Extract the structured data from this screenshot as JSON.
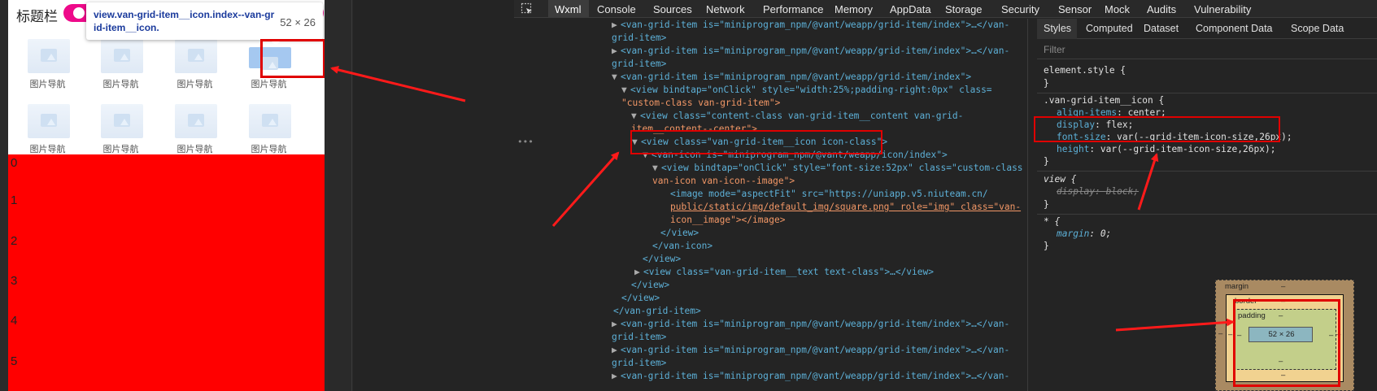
{
  "simulator": {
    "nav_title": "标题栏",
    "grid_items": [
      {
        "label": "图片导航"
      },
      {
        "label": "图片导航"
      },
      {
        "label": "图片导航"
      },
      {
        "label": "图片导航"
      },
      {
        "label": "图片导航"
      },
      {
        "label": "图片导航"
      },
      {
        "label": "图片导航"
      },
      {
        "label": "图片导航"
      }
    ],
    "red_area_numbers": [
      "0",
      "1",
      "2",
      "3",
      "4",
      "5"
    ],
    "tooltip": {
      "selector": "view.van-grid-item__icon.index--van-grid-item__icon.",
      "dimensions": "52 × 26"
    }
  },
  "devtools": {
    "tabs": [
      "Wxml",
      "Console",
      "Sources",
      "Network",
      "Performance",
      "Memory",
      "AppData",
      "Storage",
      "Security",
      "Sensor",
      "Mock",
      "Audits",
      "Vulnerability"
    ],
    "active_tab": "Wxml",
    "dom_lines": {
      "l1a": "<van-grid-item is=\"miniprogram_npm/@vant/weapp/grid-item/index\">…</van-",
      "l1b": "grid-item>",
      "l2a": "<van-grid-item is=\"miniprogram_npm/@vant/weapp/grid-item/index\">…</van-",
      "l2b": "grid-item>",
      "l3": "<van-grid-item is=\"miniprogram_npm/@vant/weapp/grid-item/index\">",
      "l4a": "<view bindtap=\"onClick\" style=\"width:25%;padding-right:0px\" class=",
      "l4b": "\"custom-class van-grid-item\">",
      "l5a": "<view class=\"content-class van-grid-item__content van-grid-",
      "l5b": "item__content--center\">",
      "l6": "<view class=\"van-grid-item__icon icon-class\">",
      "l7": "<van-icon is=\"miniprogram_npm/@vant/weapp/icon/index\">",
      "l8a": "<view bindtap=\"onClick\" style=\"font-size:52px\" class=\"custom-class",
      "l8b": "van-icon van-icon--image\">",
      "l9a": "<image mode=\"aspectFit\" src=\"https://uniapp.v5.niuteam.cn/",
      "l9b": "public/static/img/default_img/square.png\" role=\"img\" class=\"van-",
      "l9c": "icon__image\"></image>",
      "l10": "</view>",
      "l11": "</van-icon>",
      "l12": "</view>",
      "l13": "<view class=\"van-grid-item__text text-class\">…</view>",
      "l14": "</view>",
      "l15": "</view>",
      "l16": "</van-grid-item>",
      "l17a": "<van-grid-item is=\"miniprogram_npm/@vant/weapp/grid-item/index\">…</van-",
      "l17b": "grid-item>",
      "l18a": "<van-grid-item is=\"miniprogram_npm/@vant/weapp/grid-item/index\">…</van-",
      "l18b": "grid-item>",
      "l19": "<van-grid-item is=\"miniprogram_npm/@vant/weapp/grid-item/index\">…</van-"
    },
    "side_tabs": [
      "Styles",
      "Computed",
      "Dataset",
      "Component Data",
      "Scope Data"
    ],
    "active_side_tab": "Styles",
    "filter_placeholder": "Filter",
    "styles": {
      "element_style": "element.style {",
      "close": "}",
      "rule1_selector": ".van-grid-item__icon {",
      "rule1_props": [
        {
          "name": "align-items",
          "value": "center;"
        },
        {
          "name": "display",
          "value": "flex;"
        },
        {
          "name": "font-size",
          "value": "var(--grid-item-icon-size,26px);"
        },
        {
          "name": "height",
          "value": "var(--grid-item-icon-size,26px);"
        }
      ],
      "rule2_selector": "view {",
      "rule2_prop": {
        "name": "display",
        "value": "block;"
      },
      "rule3_selector": "* {",
      "rule3_prop": {
        "name": "margin",
        "value": "0;"
      }
    },
    "box_model": {
      "margin_label": "margin",
      "border_label": "border",
      "padding_label": "padding",
      "dash": "–",
      "content": "52 × 26"
    }
  }
}
